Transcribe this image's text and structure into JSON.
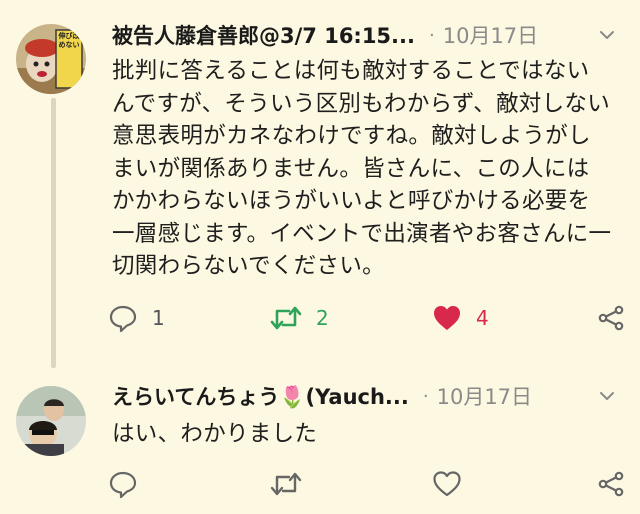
{
  "tweets": [
    {
      "display_name": "被告人藤倉善郎@3/7 16:15...",
      "separator": "·",
      "date": "10月17日",
      "text": "批判に答えることは何も敵対することではないんですが、そういう区別もわからず、敵対しない意思表明がカネなわけですね。敵対しようがしまいが関係ありません。皆さんに、この人にはかかわらないほうがいいよと呼びかける必要を一層感じます。イベントで出演者やお客さんに一切関わらないでください。",
      "reply_count": "1",
      "retweet_count": "2",
      "like_count": "4",
      "avatar_sign_text": "伸び改めない"
    },
    {
      "display_name": "えらいてんちょう🌷(Yauch...",
      "separator": "·",
      "date": "10月17日",
      "text": "はい、わかりました",
      "reply_count": "",
      "retweet_count": "",
      "like_count": ""
    }
  ],
  "icons": {
    "menu": "chevron-down-icon",
    "reply": "reply-icon",
    "retweet": "retweet-icon",
    "like": "heart-icon",
    "share": "share-icon"
  },
  "colors": {
    "background": "#fdf8e1",
    "retweet_active": "#2fa35a",
    "like_active": "#d8294a",
    "muted": "#8a8a8a"
  }
}
